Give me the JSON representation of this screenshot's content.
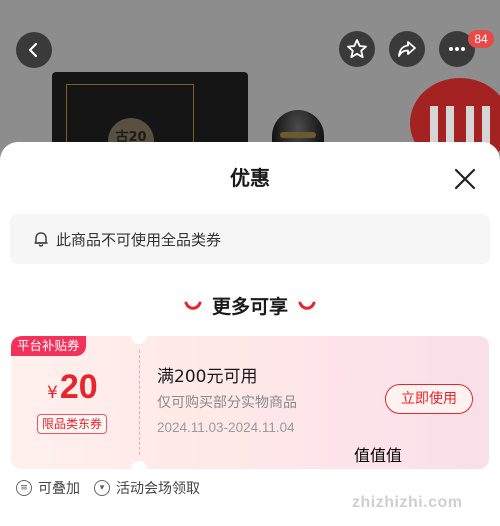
{
  "header": {
    "cart_badge": "84"
  },
  "product_image": {
    "box_seal_text": "古20"
  },
  "sheet": {
    "title": "优惠",
    "notice": "此商品不可使用全品类券",
    "section_title": "更多可享",
    "coupon": {
      "tag": "平台补贴券",
      "currency": "¥",
      "amount": "20",
      "scope": "限品类东券",
      "condition": "满200元可用",
      "description": "仅可购买部分实物商品",
      "dates": "2024.11.03-2024.11.04",
      "use_button": "立即使用",
      "accent_color": "#e8242c"
    },
    "footer": [
      {
        "icon": "stack-icon",
        "label": "可叠加"
      },
      {
        "icon": "venue-icon",
        "label": "活动会场领取"
      }
    ]
  },
  "watermark": {
    "glyphs": "值值值",
    "url": "zhizhizhi.com"
  }
}
